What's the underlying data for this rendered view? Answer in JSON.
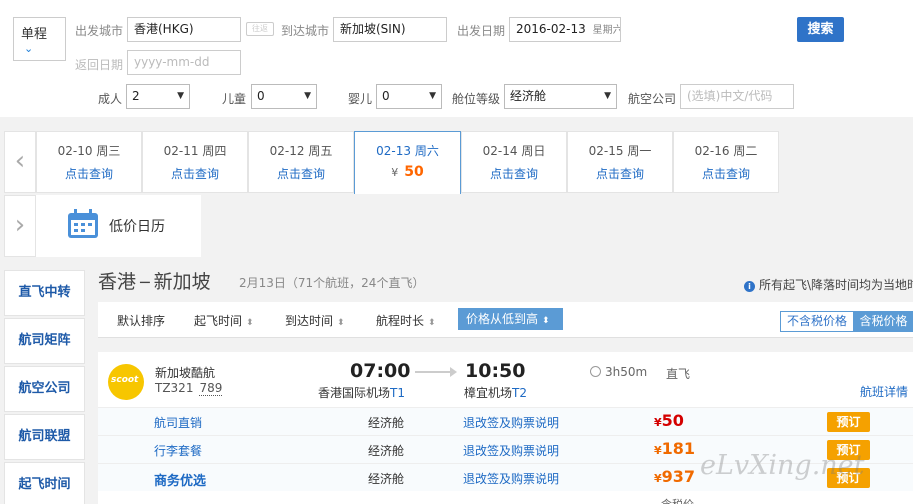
{
  "search": {
    "trip_type": "单程",
    "from_label": "出发城市",
    "from_value": "香港(HKG)",
    "swap_icon": "swap-icon",
    "swap_text": "往返",
    "to_label": "到达城市",
    "to_value": "新加坡(SIN)",
    "depart_label": "出发日期",
    "depart_value": "2016-02-13",
    "depart_weekday": "星期六",
    "return_label": "返回日期",
    "return_placeholder": "yyyy-mm-dd",
    "search_button": "搜索",
    "adult_label": "成人",
    "adult_value": "2",
    "child_label": "儿童",
    "child_value": "0",
    "infant_label": "婴儿",
    "infant_value": "0",
    "cabin_label": "舱位等级",
    "cabin_value": "经济舱",
    "airline_label": "航空公司",
    "airline_placeholder": "(选填)中文/代码"
  },
  "date_strip": {
    "prev_icon": "chevron-left-icon",
    "next_icon": "chevron-right-icon",
    "days": [
      {
        "date": "02-10 周三",
        "link": "点击查询"
      },
      {
        "date": "02-11 周四",
        "link": "点击查询"
      },
      {
        "date": "02-12 周五",
        "link": "点击查询"
      },
      {
        "date": "02-13 周六",
        "currency": "¥",
        "price": "50"
      },
      {
        "date": "02-14 周日",
        "link": "点击查询"
      },
      {
        "date": "02-15 周一",
        "link": "点击查询"
      },
      {
        "date": "02-16 周二",
        "link": "点击查询"
      }
    ],
    "calendar_label": "低价日历",
    "calendar_icon": "calendar-icon"
  },
  "sidebar": {
    "items": [
      "直飞中转",
      "航司矩阵",
      "航空公司",
      "航司联盟",
      "起飞时间"
    ]
  },
  "results": {
    "from_city": "香港",
    "to_city": "新加坡",
    "subtitle": "2月13日（71个航班，24个直飞）",
    "notice": "所有起飞\\降落时间均为当地时间",
    "sort": {
      "default": "默认排序",
      "depart_time": "起飞时间",
      "arrive_time": "到达时间",
      "duration": "航程时长",
      "price_active": "价格从低到高"
    },
    "tax_toggle": {
      "without_tax": "不含税价格",
      "with_tax": "含税价格"
    }
  },
  "flight": {
    "logo_text": "scoot",
    "airline": "新加坡酷航",
    "flight_no": "TZ321",
    "aircraft": "789",
    "dep_time": "07:00",
    "arr_time": "10:50",
    "dep_airport": "香港国际机场",
    "dep_terminal": "T1",
    "arr_airport": "樟宜机场",
    "arr_terminal": "T2",
    "duration": "3h50m",
    "stop_type": "直飞",
    "details_link": "航班详情",
    "fares": [
      {
        "name": "航司直销",
        "cabin": "经济舱",
        "rule": "退改签及购票说明",
        "currency": "¥",
        "price": "50",
        "color": "#d40000",
        "button": "预订"
      },
      {
        "name": "行李套餐",
        "cabin": "经济舱",
        "rule": "退改签及购票说明",
        "currency": "¥",
        "price": "181",
        "color": "#f06a00",
        "button": "预订"
      },
      {
        "name": "商务优选",
        "cabin": "经济舱",
        "rule": "退改签及购票说明",
        "currency": "¥",
        "price": "937",
        "color": "#f06a00",
        "button": "预订"
      }
    ],
    "tax_note": "含税价"
  },
  "watermark": "eLvXing.net"
}
